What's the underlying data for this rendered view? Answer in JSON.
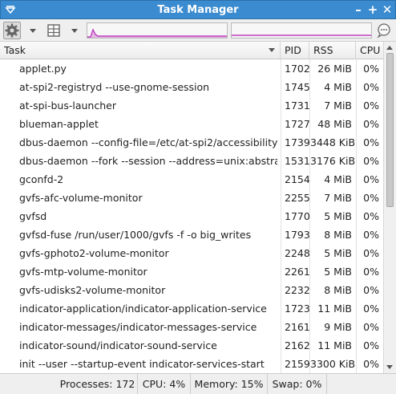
{
  "window": {
    "title": "Task Manager"
  },
  "toolbar": {
    "settings_icon": "gear-icon",
    "view_icon": "columns-icon",
    "info_icon": "speech-bubble-icon",
    "cpu_graph_color": "#c040c0",
    "memory_graph_color": "#c040c0"
  },
  "table": {
    "headers": {
      "task": "Task",
      "pid": "PID",
      "rss": "RSS",
      "cpu": "CPU"
    },
    "rows": [
      {
        "task": "applet.py",
        "pid": "1702",
        "rss": "26 MiB",
        "cpu": "0%"
      },
      {
        "task": "at-spi2-registryd --use-gnome-session",
        "pid": "1745",
        "rss": "4 MiB",
        "cpu": "0%"
      },
      {
        "task": "at-spi-bus-launcher",
        "pid": "1731",
        "rss": "7 MiB",
        "cpu": "0%"
      },
      {
        "task": "blueman-applet",
        "pid": "1727",
        "rss": "48 MiB",
        "cpu": "0%"
      },
      {
        "task": "dbus-daemon --config-file=/etc/at-spi2/accessibility....",
        "pid": "1739",
        "rss": "3448 KiB",
        "cpu": "0%"
      },
      {
        "task": "dbus-daemon --fork --session --address=unix:abstra...",
        "pid": "1531",
        "rss": "3176 KiB",
        "cpu": "0%"
      },
      {
        "task": "gconfd-2",
        "pid": "2154",
        "rss": "4 MiB",
        "cpu": "0%"
      },
      {
        "task": "gvfs-afc-volume-monitor",
        "pid": "2255",
        "rss": "7 MiB",
        "cpu": "0%"
      },
      {
        "task": "gvfsd",
        "pid": "1770",
        "rss": "5 MiB",
        "cpu": "0%"
      },
      {
        "task": "gvfsd-fuse /run/user/1000/gvfs -f -o big_writes",
        "pid": "1793",
        "rss": "8 MiB",
        "cpu": "0%"
      },
      {
        "task": "gvfs-gphoto2-volume-monitor",
        "pid": "2248",
        "rss": "5 MiB",
        "cpu": "0%"
      },
      {
        "task": "gvfs-mtp-volume-monitor",
        "pid": "2261",
        "rss": "5 MiB",
        "cpu": "0%"
      },
      {
        "task": "gvfs-udisks2-volume-monitor",
        "pid": "2232",
        "rss": "8 MiB",
        "cpu": "0%"
      },
      {
        "task": "indicator-application/indicator-application-service",
        "pid": "1723",
        "rss": "11 MiB",
        "cpu": "0%"
      },
      {
        "task": "indicator-messages/indicator-messages-service",
        "pid": "2161",
        "rss": "9 MiB",
        "cpu": "0%"
      },
      {
        "task": "indicator-sound/indicator-sound-service",
        "pid": "2162",
        "rss": "11 MiB",
        "cpu": "0%"
      },
      {
        "task": "init --user --startup-event indicator-services-start",
        "pid": "2159",
        "rss": "3300 KiB",
        "cpu": "0%"
      }
    ]
  },
  "statusbar": {
    "processes": "Processes: 172",
    "cpu": "CPU: 4%",
    "memory": "Memory: 15%",
    "swap": "Swap: 0%"
  }
}
